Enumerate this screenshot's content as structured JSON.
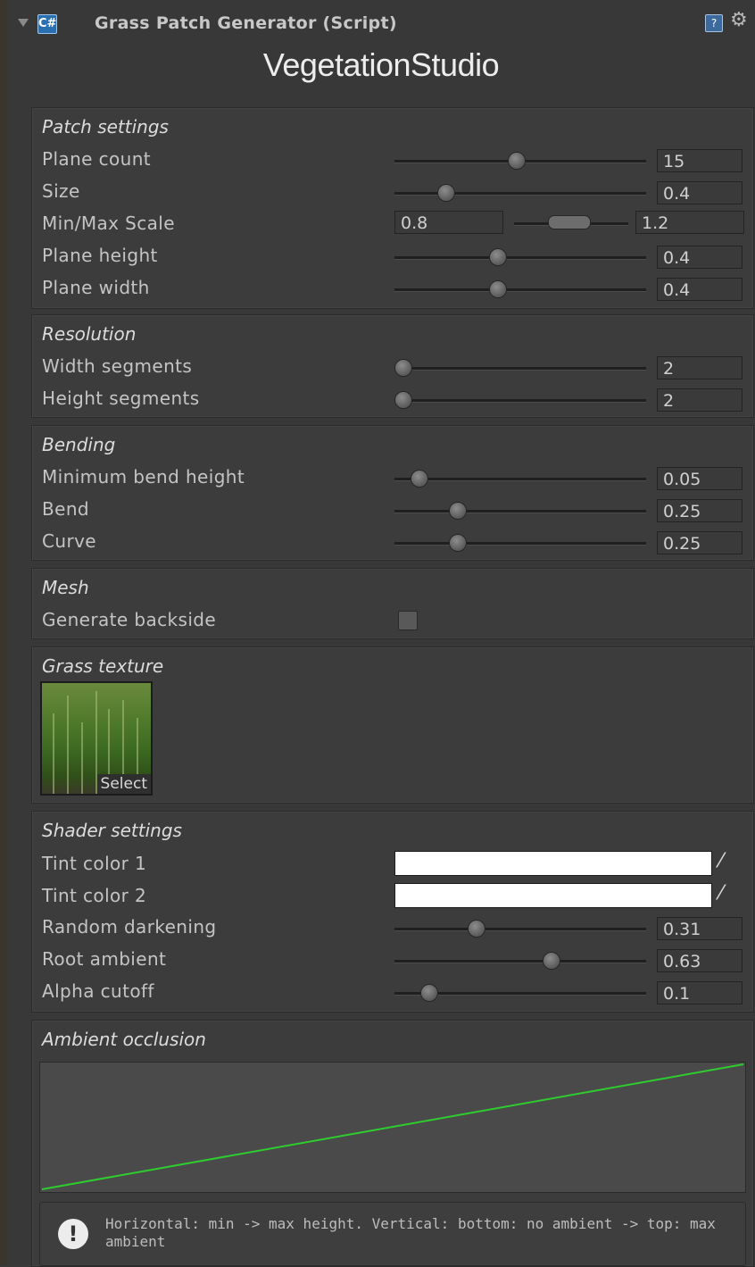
{
  "header": {
    "title": "Grass Patch Generator (Script)",
    "script_icon": "C#",
    "help_icon": "?",
    "gear_icon": "⚙"
  },
  "logo": {
    "text_left": "Vegetation",
    "text_right": "Studio"
  },
  "sections": {
    "patch": {
      "title": "Patch settings",
      "rows": [
        {
          "label": "Plane count",
          "value": "15",
          "level": 0.48
        },
        {
          "label": "Size",
          "value": "0.4",
          "level": 0.18
        },
        {
          "label": "Plane height",
          "value": "0.4",
          "level": 0.4
        },
        {
          "label": "Plane width",
          "value": "0.4",
          "level": 0.4
        }
      ],
      "minmax": {
        "label": "Min/Max Scale",
        "min": "0.8",
        "max": "1.2"
      }
    },
    "resolution": {
      "title": "Resolution",
      "rows": [
        {
          "label": "Width segments",
          "value": "2",
          "level": 0.0
        },
        {
          "label": "Height segments",
          "value": "2",
          "level": 0.0
        }
      ]
    },
    "bending": {
      "title": "Bending",
      "rows": [
        {
          "label": "Minimum bend height",
          "value": "0.05",
          "level": 0.07
        },
        {
          "label": "Bend",
          "value": "0.25",
          "level": 0.23
        },
        {
          "label": "Curve",
          "value": "0.25",
          "level": 0.23
        }
      ]
    },
    "mesh": {
      "title": "Mesh",
      "backside_label": "Generate backside"
    },
    "texture": {
      "title": "Grass texture",
      "select_label": "Select"
    },
    "shader": {
      "title": "Shader settings",
      "tint1_label": "Tint color 1",
      "tint2_label": "Tint color 2",
      "tint1_color": "#ffffff",
      "tint2_color": "#ffffff",
      "rows": [
        {
          "label": "Random darkening",
          "value": "0.31",
          "level": 0.31
        },
        {
          "label": "Root ambient",
          "value": "0.63",
          "level": 0.63
        },
        {
          "label": "Alpha cutoff",
          "value": "0.1",
          "level": 0.11
        }
      ]
    },
    "ao": {
      "title": "Ambient occlusion",
      "help_text": "Horizontal: min -> max height. Vertical: bottom: no ambient -> top: max ambient",
      "curve_color": "#2ecc2e"
    }
  }
}
